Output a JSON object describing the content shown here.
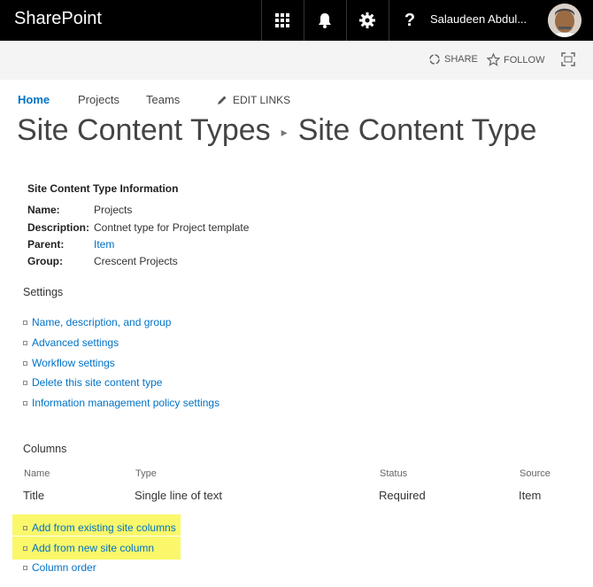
{
  "suitebar": {
    "brand": "SharePoint",
    "user_name": "Salaudeen Abdul..."
  },
  "ribbon": {
    "share_label": "SHARE",
    "follow_label": "FOLLOW"
  },
  "topnav": {
    "items": [
      "Home",
      "Projects",
      "Teams"
    ],
    "edit_links": "EDIT LINKS"
  },
  "page_title": {
    "crumb": "Site Content Types",
    "current": "Site Content Type"
  },
  "info": {
    "heading": "Site Content Type Information",
    "rows": [
      {
        "label": "Name:",
        "value": "Projects"
      },
      {
        "label": "Description:",
        "value": "Contnet type for Project template"
      },
      {
        "label": "Parent:",
        "value": "Item"
      },
      {
        "label": "Group:",
        "value": "Crescent Projects"
      }
    ]
  },
  "settings": {
    "heading": "Settings",
    "links": [
      "Name, description, and group",
      "Advanced settings",
      "Workflow settings",
      "Delete this site content type",
      "Information management policy settings"
    ]
  },
  "columns": {
    "heading": "Columns",
    "headers": [
      "Name",
      "Type",
      "Status",
      "Source"
    ],
    "rows": [
      {
        "name": "Title",
        "type": "Single line of text",
        "status": "Required",
        "source": "Item"
      }
    ],
    "links": [
      "Add from existing site columns",
      "Add from new site column",
      "Column order"
    ]
  },
  "colors": {
    "suitebar_bg": "#000000",
    "link": "#0072c6",
    "highlight": "#faf86a"
  }
}
